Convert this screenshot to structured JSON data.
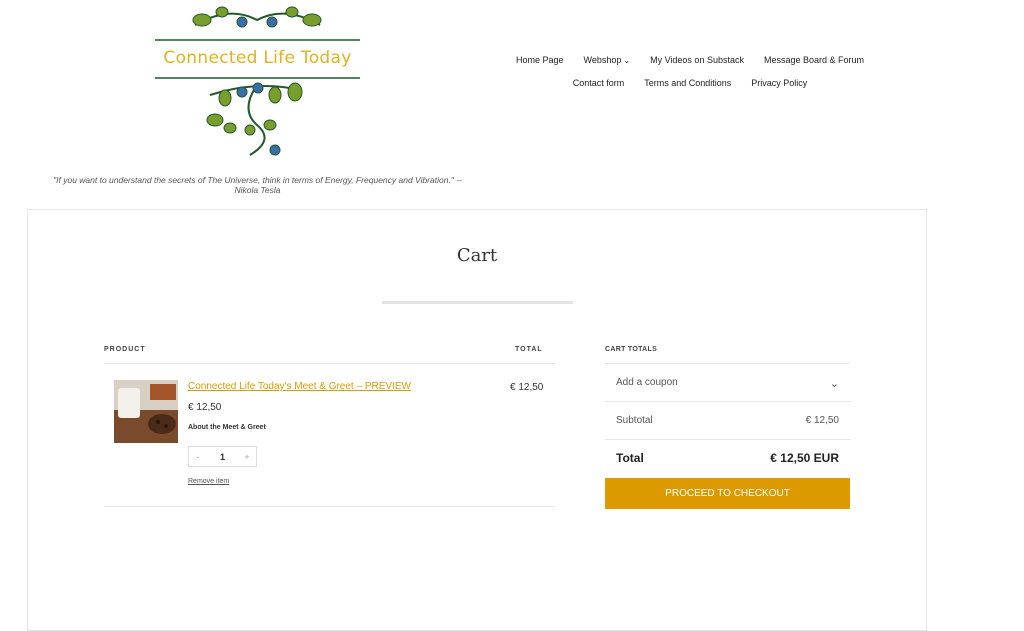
{
  "header": {
    "logo_text": "Connected Life Today",
    "tagline": "\"If you want to understand the secrets of The Universe, think in terms of Energy, Frequency and Vibration.\" -- Nikola Tesla"
  },
  "nav": {
    "row1": [
      "Home Page",
      "Webshop",
      "My Videos on Substack",
      "Message Board & Forum"
    ],
    "row2": [
      "Contact form",
      "Terms and Conditions",
      "Privacy Policy"
    ]
  },
  "cart": {
    "title": "Cart",
    "col_product": "PRODUCT",
    "col_total": "TOTAL",
    "item": {
      "name": "Connected Life Today's Meet & Greet – PREVIEW",
      "price": "€ 12,50",
      "description": "About the Meet & Greet",
      "qty_minus": "-",
      "qty": "1",
      "qty_plus": "+",
      "remove": "Remove item",
      "total": "€ 12,50"
    }
  },
  "totals": {
    "heading": "CART TOTALS",
    "coupon": "Add a coupon",
    "subtotal_label": "Subtotal",
    "subtotal_value": "€ 12,50",
    "total_label": "Total",
    "total_value": "€ 12,50 EUR",
    "checkout": "PROCEED TO CHECKOUT"
  },
  "colors": {
    "accent": "#dd9a00",
    "logo_text": "#e3b21a",
    "leaf_green": "#7a9e2b",
    "vine": "#1f5a2a"
  }
}
